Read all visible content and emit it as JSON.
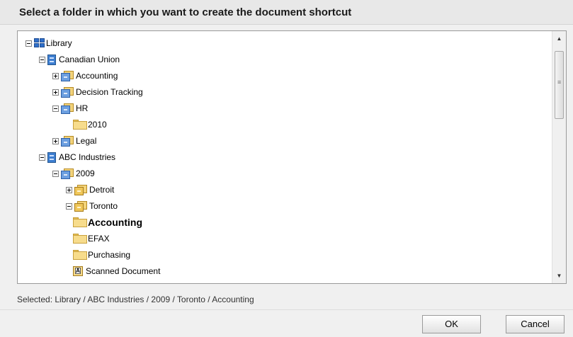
{
  "dialog": {
    "title": "Select a folder in which you want to create the document shortcut",
    "selected_text": "Selected: Library / ABC Industries / 2009 / Toronto / Accounting",
    "ok_label": "OK",
    "cancel_label": "Cancel"
  },
  "tree": {
    "nodes": [
      {
        "label": "Library",
        "icon": "library-icon",
        "toggle": "minus"
      },
      {
        "label": "Canadian Union",
        "icon": "server-icon",
        "toggle": "minus"
      },
      {
        "label": "Accounting",
        "icon": "cabinet-icon",
        "toggle": "plus"
      },
      {
        "label": "Decision Tracking",
        "icon": "cabinet-icon",
        "toggle": "plus"
      },
      {
        "label": "HR",
        "icon": "cabinet-icon",
        "toggle": "minus"
      },
      {
        "label": "2010",
        "icon": "folder-icon",
        "toggle": ""
      },
      {
        "label": "Legal",
        "icon": "cabinet-icon",
        "toggle": "plus"
      },
      {
        "label": "ABC Industries",
        "icon": "server-icon",
        "toggle": "minus"
      },
      {
        "label": "2009",
        "icon": "cabinet-icon",
        "toggle": "minus"
      },
      {
        "label": "Detroit",
        "icon": "drawer-icon",
        "toggle": "plus"
      },
      {
        "label": "Toronto",
        "icon": "drawer-icon",
        "toggle": "minus"
      },
      {
        "label": "Accounting",
        "icon": "folder-icon",
        "toggle": "",
        "selected": true
      },
      {
        "label": "EFAX",
        "icon": "folder-icon",
        "toggle": ""
      },
      {
        "label": "Purchasing",
        "icon": "folder-icon",
        "toggle": ""
      },
      {
        "label": "Scanned Document",
        "icon": "document-icon",
        "toggle": "",
        "doc_letter": "A"
      }
    ]
  },
  "scrollbar": {
    "up_glyph": "▲",
    "down_glyph": "▼",
    "grip_glyph": "≡"
  }
}
